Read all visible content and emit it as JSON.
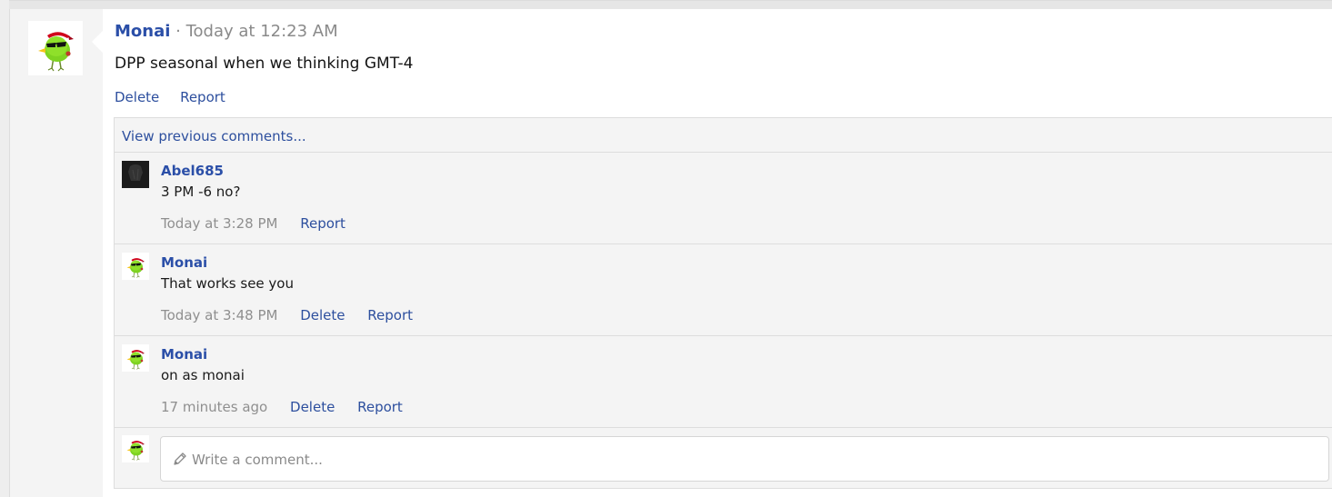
{
  "post": {
    "author": "Monai",
    "timestamp": "· Today at 12:23 AM",
    "body": "DPP seasonal when we thinking GMT-4",
    "actions": {
      "delete": "Delete",
      "report": "Report"
    }
  },
  "comments_section": {
    "view_previous": "View previous comments...",
    "comments": [
      {
        "author": "Abel685",
        "text": "3 PM -6 no?",
        "time": "Today at 3:28 PM",
        "report": "Report"
      },
      {
        "author": "Monai",
        "text": "That works see you",
        "time": "Today at 3:48 PM",
        "delete": "Delete",
        "report": "Report"
      },
      {
        "author": "Monai",
        "text": "on as monai",
        "time": "17 minutes ago",
        "delete": "Delete",
        "report": "Report"
      }
    ],
    "compose": {
      "placeholder": "Write a comment..."
    }
  },
  "icons": {
    "avatar": "green-bird-sunglasses-avatar",
    "compose": "pencil-icon"
  },
  "colors": {
    "link": "#2d4f9e",
    "author": "#2b4fa8",
    "muted": "#8f8f8f"
  }
}
